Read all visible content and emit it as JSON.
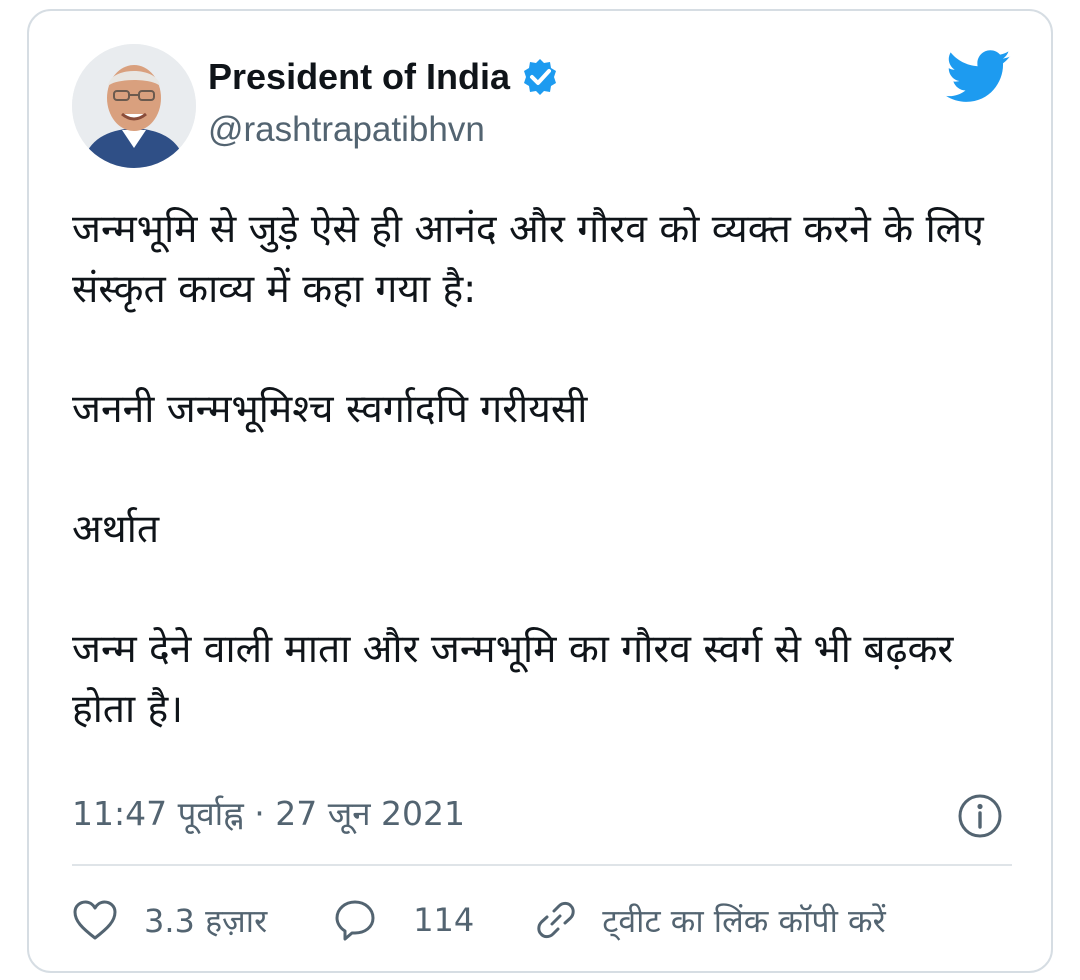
{
  "author": {
    "name": "President of India",
    "handle": "@rashtrapatibhvn",
    "verified": true,
    "avatar_icon": "avatar-portrait",
    "brand_icon": "twitter-bird-icon",
    "brand_color": "#1d9bf0"
  },
  "tweet": {
    "lines": [
      "जन्मभूमि से जुड़े ऐसे ही आनंद और गौरव को व्यक्त करने के लिए संस्कृत काव्य में कहा गया है:",
      "जननी जन्मभूमिश्च स्वर्गादपि गरीयसी",
      "अर्थात",
      "जन्म देने वाली माता और जन्मभूमि का गौरव स्वर्ग से भी बढ़कर होता है।"
    ],
    "timestamp": "11:47 पूर्वाह्न · 27 जून 2021"
  },
  "actions": {
    "like_count": "3.3 हज़ार",
    "reply_count": "114",
    "copy_link_label": "ट्वीट का लिंक कॉपी करें"
  },
  "colors": {
    "text_primary": "#0f1419",
    "text_secondary": "#536471",
    "border": "#d6dde3",
    "verified": "#1d9bf0"
  }
}
